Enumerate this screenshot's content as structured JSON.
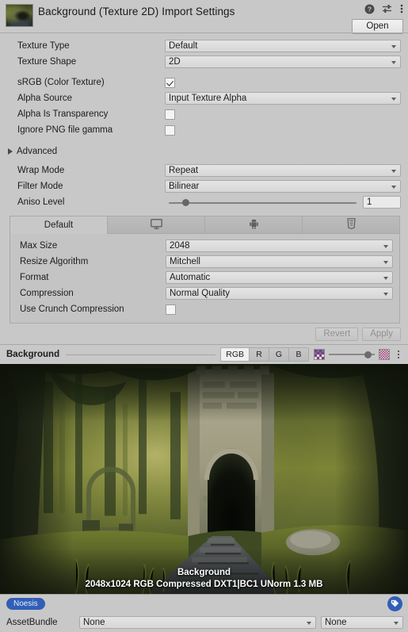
{
  "header": {
    "title": "Background (Texture 2D) Import Settings",
    "open_label": "Open",
    "help_icon": "help-icon",
    "preset_icon": "preset-icon",
    "menu_icon": "kebab-menu-icon",
    "thumbnail_icon": "texture-thumbnail"
  },
  "properties": {
    "texture_type": {
      "label": "Texture Type",
      "value": "Default"
    },
    "texture_shape": {
      "label": "Texture Shape",
      "value": "2D"
    },
    "srgb": {
      "label": "sRGB (Color Texture)",
      "checked": "true"
    },
    "alpha_source": {
      "label": "Alpha Source",
      "value": "Input Texture Alpha"
    },
    "alpha_is_transparency": {
      "label": "Alpha Is Transparency",
      "checked": "false"
    },
    "ignore_png_gamma": {
      "label": "Ignore PNG file gamma",
      "checked": "false"
    },
    "advanced": {
      "label": "Advanced",
      "expanded": "false"
    },
    "wrap_mode": {
      "label": "Wrap Mode",
      "value": "Repeat"
    },
    "filter_mode": {
      "label": "Filter Mode",
      "value": "Bilinear"
    },
    "aniso_level": {
      "label": "Aniso Level",
      "value": "1"
    }
  },
  "platform_tabs": [
    {
      "label": "Default",
      "icon": "text",
      "selected": "true"
    },
    {
      "label": "",
      "icon": "monitor-icon",
      "selected": "false"
    },
    {
      "label": "",
      "icon": "android-icon",
      "selected": "false"
    },
    {
      "label": "",
      "icon": "html5-icon",
      "selected": "false"
    }
  ],
  "platform_settings": {
    "max_size": {
      "label": "Max Size",
      "value": "2048"
    },
    "resize_algorithm": {
      "label": "Resize Algorithm",
      "value": "Mitchell"
    },
    "format": {
      "label": "Format",
      "value": "Automatic"
    },
    "compression": {
      "label": "Compression",
      "value": "Normal Quality"
    },
    "use_crunch": {
      "label": "Use Crunch Compression",
      "checked": "false"
    }
  },
  "apply_bar": {
    "revert_label": "Revert",
    "apply_label": "Apply"
  },
  "preview": {
    "title": "Background",
    "channels": [
      {
        "label": "RGB",
        "selected": "true"
      },
      {
        "label": "R",
        "selected": "false"
      },
      {
        "label": "G",
        "selected": "false"
      },
      {
        "label": "B",
        "selected": "false"
      }
    ],
    "info_name": "Background",
    "info_details": "2048x1024  RGB Compressed DXT1|BC1 UNorm   1.3 MB",
    "mip_low_icon": "checkerboard-icon",
    "mip_high_icon": "checkerboard-icon",
    "options_icon": "kebab-menu-icon"
  },
  "bottom": {
    "label_pill": "Noesis",
    "tag_icon": "tag-icon",
    "assetbundle_label": "AssetBundle",
    "assetbundle_value": "None",
    "variant_value": "None"
  },
  "colors": {
    "window_bg": "#c8c8c8",
    "field_bg": "#dcdcdc",
    "accent_blue": "#315fb5",
    "disabled_text": "#909090"
  }
}
